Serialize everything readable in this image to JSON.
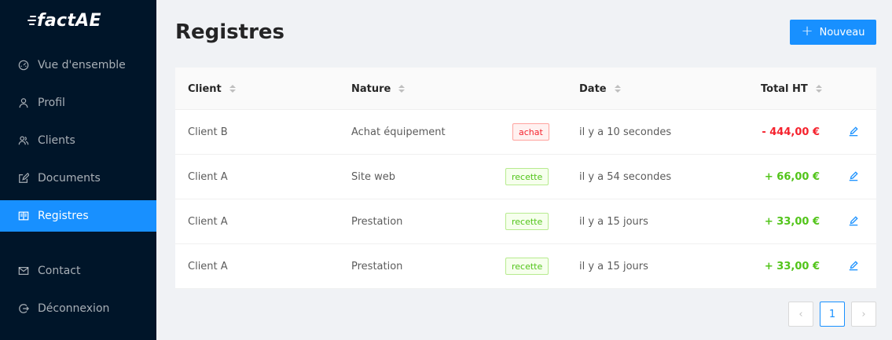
{
  "app": {
    "logo_text": "factAE"
  },
  "sidebar": {
    "items": [
      {
        "label": "Vue d'ensemble",
        "icon": "dashboard-icon"
      },
      {
        "label": "Profil",
        "icon": "user-icon"
      },
      {
        "label": "Clients",
        "icon": "team-icon"
      },
      {
        "label": "Documents",
        "icon": "form-icon"
      },
      {
        "label": "Registres",
        "icon": "book-icon",
        "active": true
      },
      {
        "label": "Contact",
        "icon": "mail-icon"
      },
      {
        "label": "Déconnexion",
        "icon": "logout-icon"
      }
    ]
  },
  "page": {
    "title": "Registres",
    "new_button_label": "Nouveau"
  },
  "table": {
    "columns": [
      "Client",
      "Nature",
      "Date",
      "Total HT"
    ],
    "rows": [
      {
        "client": "Client B",
        "nature": "Achat équipement",
        "tag": "achat",
        "date": "il y a 10 secondes",
        "total": "- 444,00 €",
        "sign": "neg"
      },
      {
        "client": "Client A",
        "nature": "Site web",
        "tag": "recette",
        "date": "il y a 54 secondes",
        "total": "+ 66,00 €",
        "sign": "pos"
      },
      {
        "client": "Client A",
        "nature": "Prestation",
        "tag": "recette",
        "date": "il y a 15 jours",
        "total": "+ 33,00 €",
        "sign": "pos"
      },
      {
        "client": "Client A",
        "nature": "Prestation",
        "tag": "recette",
        "date": "il y a 15 jours",
        "total": "+ 33,00 €",
        "sign": "pos"
      }
    ]
  },
  "pagination": {
    "prev": "‹",
    "current_page": "1",
    "next": "›"
  },
  "colors": {
    "sidebar_bg": "#001529",
    "primary": "#1890ff",
    "negative": "#f5222d",
    "positive": "#52c41a"
  }
}
